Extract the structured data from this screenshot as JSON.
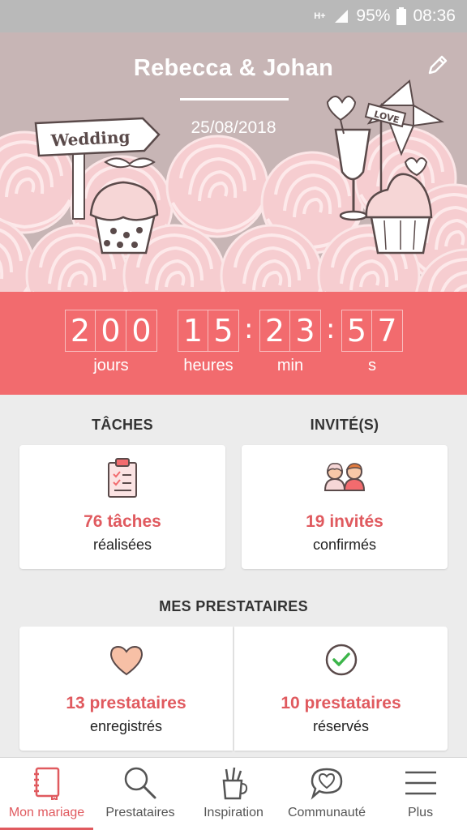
{
  "status_bar": {
    "network": "H+",
    "battery": "95%",
    "time": "08:36"
  },
  "hero": {
    "couple_names": "Rebecca & Johan",
    "wedding_date": "25/08/2018",
    "sign_text": "Wedding",
    "flag_text": "LOVE",
    "edit_icon": "pencil-icon"
  },
  "countdown": {
    "days": [
      "2",
      "0",
      "0"
    ],
    "hours": [
      "1",
      "5"
    ],
    "minutes": [
      "2",
      "3"
    ],
    "seconds": [
      "5",
      "7"
    ],
    "separator": ":",
    "labels": {
      "days": "jours",
      "hours": "heures",
      "minutes": "min",
      "seconds": "s"
    }
  },
  "tasks": {
    "title": "TÂCHES",
    "count_text": "76 tâches",
    "sub_text": "réalisées",
    "icon": "clipboard-icon"
  },
  "guests": {
    "title": "INVITÉ(S)",
    "count_text": "19 invités",
    "sub_text": "confirmés",
    "icon": "couple-icon"
  },
  "vendors": {
    "title": "MES PRESTATAIRES",
    "saved": {
      "count_text": "13 prestataires",
      "sub_text": "enregistrés",
      "icon": "heart-icon"
    },
    "booked": {
      "count_text": "10 prestataires",
      "sub_text": "réservés",
      "icon": "check-circle-icon"
    }
  },
  "nav": {
    "items": [
      {
        "label": "Mon mariage",
        "icon": "notebook-icon",
        "active": true
      },
      {
        "label": "Prestataires",
        "icon": "search-icon",
        "active": false
      },
      {
        "label": "Inspiration",
        "icon": "pencil-cup-icon",
        "active": false
      },
      {
        "label": "Communauté",
        "icon": "heart-chat-icon",
        "active": false
      },
      {
        "label": "Plus",
        "icon": "menu-icon",
        "active": false
      }
    ]
  },
  "colors": {
    "accent": "#f26b6e",
    "accent_text": "#e05a5f",
    "hero_bg": "#c7b5b5",
    "rose_pink": "#f4c9cc"
  }
}
